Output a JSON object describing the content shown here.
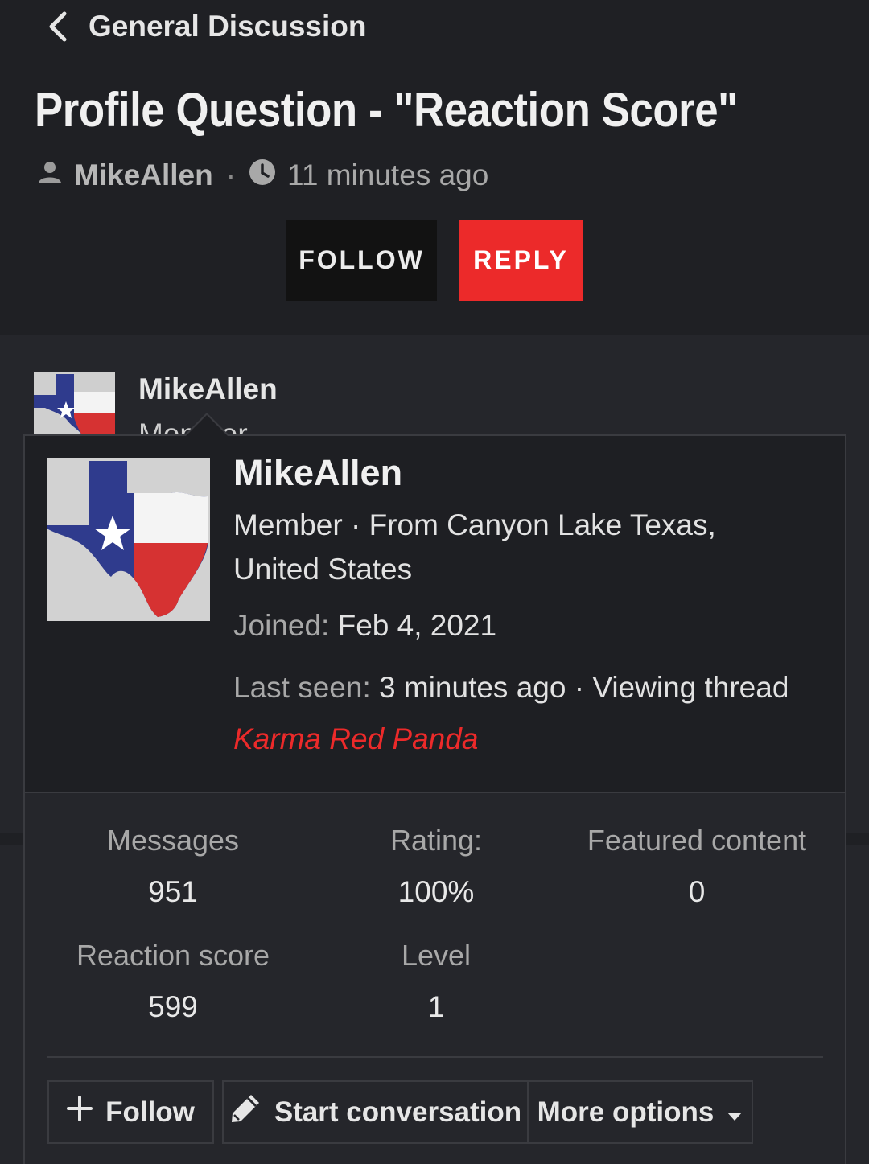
{
  "breadcrumb": {
    "label": "General Discussion",
    "icon": "chevron-left-icon"
  },
  "thread": {
    "title": "Profile Question - \"Reaction Score\"",
    "author": "MikeAllen",
    "time": "11 minutes ago",
    "follow_label": "FOLLOW",
    "reply_label": "REPLY"
  },
  "post": {
    "username": "MikeAllen",
    "role": "Member"
  },
  "popup": {
    "username": "MikeAllen",
    "info_line1": "Member · From Canyon Lake Texas,",
    "info_line2": "United States",
    "joined_label": "Joined:",
    "joined_value": "Feb 4, 2021",
    "last_seen_label": "Last seen:",
    "last_seen_value": "3 minutes ago · Viewing thread",
    "karma": "Karma Red Panda",
    "stats": [
      {
        "label": "Messages",
        "value": "951"
      },
      {
        "label": "Rating:",
        "value": "100%"
      },
      {
        "label": "Featured content",
        "value": "0"
      },
      {
        "label": "Reaction score",
        "value": "599"
      },
      {
        "label": "Level",
        "value": "1"
      }
    ],
    "actions": {
      "follow_label": "Follow",
      "conversation_label": "Start conversation",
      "more_label": "More options"
    }
  },
  "colors": {
    "accent_red": "#ec2a2a",
    "header_bg": "#1f2024",
    "page_bg": "#25262b"
  }
}
